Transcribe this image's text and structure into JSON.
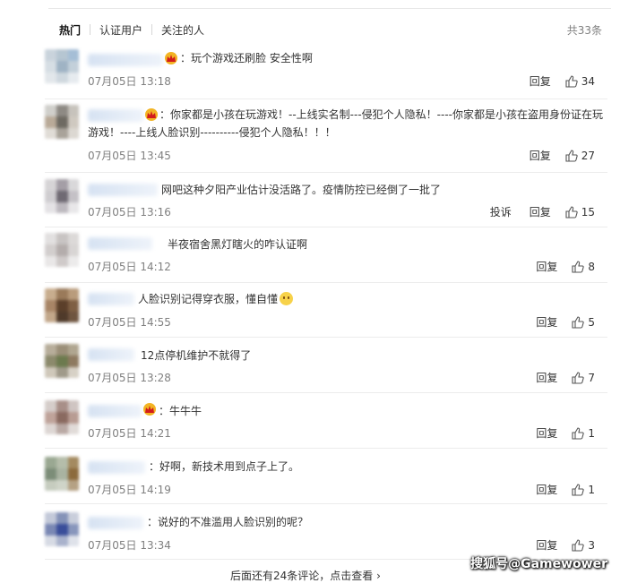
{
  "tabs": [
    {
      "label": "热门",
      "active": true
    },
    {
      "label": "认证用户",
      "active": false
    },
    {
      "label": "关注的人",
      "active": false
    }
  ],
  "total_count": "共33条",
  "labels": {
    "reply": "回复",
    "report": "投诉",
    "more": "后面还有24条评论，点击查看 ›"
  },
  "watermark": "搜狐号@Gamewower",
  "colors": {
    "accent": "#333333",
    "meta": "#808080",
    "vip": "#f2b424"
  },
  "comments": [
    {
      "text": "：玩个游戏还刷脸 安全性啊",
      "date": "07月05日 13:18",
      "likes": "34",
      "vip": true
    },
    {
      "text": "：你家都是小孩在玩游戏！--上线实名制---侵犯个人隐私！----你家都是小孩在盗用身份证在玩游戏！----上线人脸识别----------侵犯个人隐私！！！",
      "date": "07月05日 13:45",
      "likes": "27",
      "vip": true
    },
    {
      "text": "网吧这种夕阳产业估计没活路了。疫情防控已经倒了一批了",
      "date": "07月05日 13:16",
      "likes": "15",
      "vip": false
    },
    {
      "text": "半夜宿舍黑灯瞎火的咋认证啊",
      "date": "07月05日 14:12",
      "likes": "8",
      "vip": false
    },
    {
      "text": "人脸识别记得穿衣服，懂自懂",
      "date": "07月05日 14:55",
      "likes": "5",
      "vip": false
    },
    {
      "text": "12点停机维护不就得了",
      "date": "07月05日 13:28",
      "likes": "7",
      "vip": false
    },
    {
      "text": "：牛牛牛",
      "date": "07月05日 14:21",
      "likes": "1",
      "vip": true
    },
    {
      "text": "：好啊，新技术用到点子上了。",
      "date": "07月05日 14:19",
      "likes": "1",
      "vip": false
    },
    {
      "text": "：说好的不准滥用人脸识别的呢？",
      "date": "07月05日 13:34",
      "likes": "3",
      "vip": false
    }
  ]
}
